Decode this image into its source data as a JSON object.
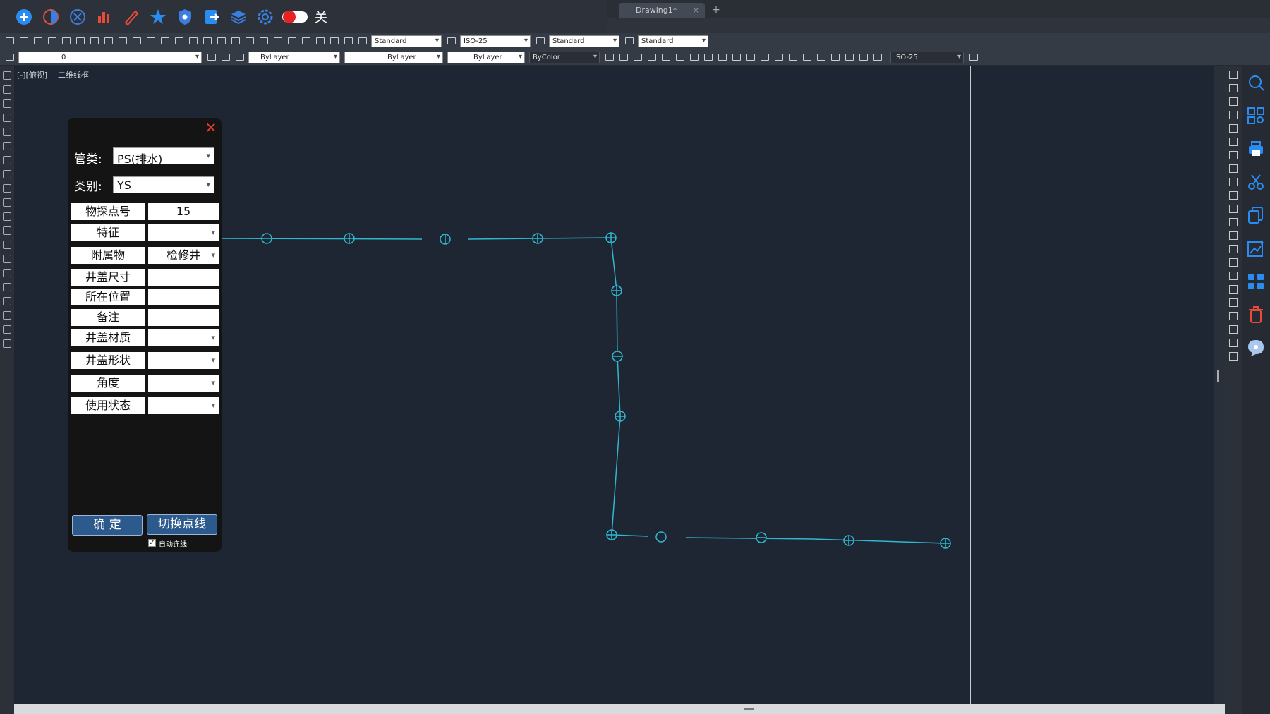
{
  "plugin_bar": {
    "toggle_label": "关"
  },
  "tabs": {
    "document": "Drawing1*",
    "close": "×",
    "new": "+"
  },
  "toolbar1": {
    "text_style": "Standard",
    "dim_style": "ISO-25",
    "table_style": "Standard",
    "multileader_style": "Standard"
  },
  "toolbar2": {
    "layer": "0",
    "color": "ByLayer",
    "linetype": "ByLayer",
    "lineweight": "ByLayer",
    "plot_style": "ByColor",
    "dim_style": "ISO-25"
  },
  "canvas": {
    "viewport_label": "[-][俯视]",
    "layout_label": "二维线框",
    "line_color": "#2fb8cf"
  },
  "dialog": {
    "pipe_type_label": "管类:",
    "pipe_type_value": "PS(排水)",
    "category_label": "类别:",
    "category_value": "YS",
    "fields": [
      {
        "label": "物探点号",
        "value": "15",
        "select": false
      },
      {
        "label": "特征",
        "value": "",
        "select": true
      },
      {
        "label": "附属物",
        "value": "检修井",
        "select": true
      },
      {
        "label": "井盖尺寸",
        "value": "",
        "select": false
      },
      {
        "label": "所在位置",
        "value": "",
        "select": false
      },
      {
        "label": "备注",
        "value": "",
        "select": false
      },
      {
        "label": "井盖材质",
        "value": "",
        "select": true
      },
      {
        "label": "井盖形状",
        "value": "",
        "select": true
      },
      {
        "label": "角度",
        "value": "",
        "select": true
      },
      {
        "label": "使用状态",
        "value": "",
        "select": true
      }
    ],
    "confirm_button": "确  定",
    "switch_button": "切换点线",
    "auto_connect_label": "自动连线",
    "auto_connect_checked": true,
    "close_color": "#e0402a"
  }
}
